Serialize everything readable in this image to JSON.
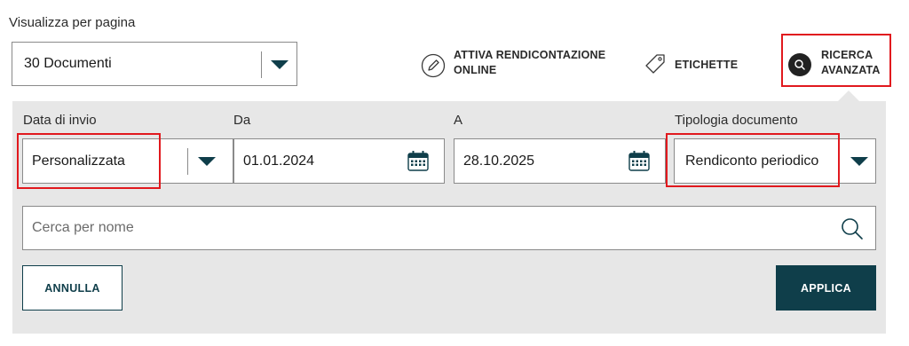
{
  "per_page": {
    "label": "Visualizza per pagina",
    "value": "30 Documenti"
  },
  "actions": {
    "online_reporting": {
      "line1": "ATTIVA RENDICONTAZIONE",
      "line2": "ONLINE",
      "icon": "pencil-icon"
    },
    "labels": {
      "label": "ETICHETTE",
      "icon": "tag-icon"
    },
    "advanced_search": {
      "line1": "RICERCA",
      "line2": "AVANZATA",
      "icon": "search-icon"
    }
  },
  "filters": {
    "send_date": {
      "label": "Data di invio",
      "value": "Personalizzata"
    },
    "from": {
      "label": "Da",
      "value": "01.01.2024",
      "icon": "calendar-icon"
    },
    "to": {
      "label": "A",
      "value": "28.10.2025",
      "icon": "calendar-icon"
    },
    "doc_type": {
      "label": "Tipologia documento",
      "value": "Rendiconto periodico"
    }
  },
  "search": {
    "placeholder": "Cerca per nome",
    "icon": "search-icon"
  },
  "buttons": {
    "cancel": "ANNULLA",
    "apply": "APPLICA"
  },
  "colors": {
    "accent": "#0f3e4a",
    "highlight": "#e1191e",
    "panel": "#e7e7e7"
  }
}
